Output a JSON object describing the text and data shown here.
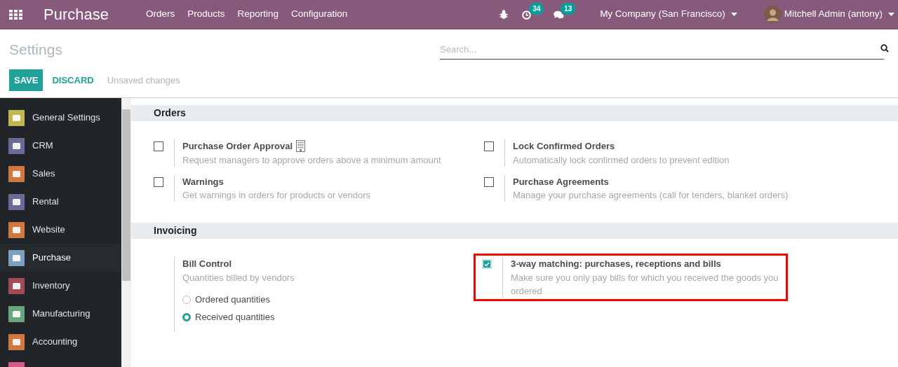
{
  "navbar": {
    "app_name": "Purchase",
    "menu": [
      "Orders",
      "Products",
      "Reporting",
      "Configuration"
    ],
    "activity_count": "34",
    "message_count": "13",
    "company": "My Company (San Francisco)",
    "user": "Mitchell Admin (antony)"
  },
  "control_panel": {
    "title": "Settings",
    "search": {
      "placeholder": "Search..."
    },
    "save": "SAVE",
    "discard": "DISCARD",
    "status": "Unsaved changes"
  },
  "sidebar": {
    "items": [
      {
        "label": "General Settings",
        "color": "#c2b64e",
        "selected": false
      },
      {
        "label": "CRM",
        "color": "#6c6a99",
        "selected": false
      },
      {
        "label": "Sales",
        "color": "#d2773f",
        "selected": false
      },
      {
        "label": "Rental",
        "color": "#6c6a99",
        "selected": false
      },
      {
        "label": "Website",
        "color": "#d2773f",
        "selected": false
      },
      {
        "label": "Purchase",
        "color": "#7ca2c2",
        "selected": true
      },
      {
        "label": "Inventory",
        "color": "#a34a55",
        "selected": false
      },
      {
        "label": "Manufacturing",
        "color": "#66a67a",
        "selected": false
      },
      {
        "label": "Accounting",
        "color": "#d2773f",
        "selected": false
      },
      {
        "color": "#d45a8a"
      }
    ]
  },
  "sections": [
    {
      "title": "Orders",
      "settings": [
        {
          "kind": "checkbox",
          "checked": false,
          "title": "Purchase Order Approval",
          "enterprise": true,
          "description": "Request managers to approve orders above a minimum amount"
        },
        {
          "kind": "checkbox",
          "checked": false,
          "title": "Lock Confirmed Orders",
          "description": "Automatically lock confirmed orders to prevent edition"
        },
        {
          "kind": "checkbox",
          "checked": false,
          "title": "Warnings",
          "description": "Get warnings in orders for products or vendors"
        },
        {
          "kind": "checkbox",
          "checked": false,
          "title": "Purchase Agreements",
          "description": "Manage your purchase agreements (call for tenders, blanket orders)"
        }
      ]
    },
    {
      "title": "Invoicing",
      "settings": [
        {
          "kind": "radio",
          "title": "Bill Control",
          "description": "Quantities billed by vendors",
          "options": [
            {
              "label": "Ordered quantities",
              "selected": false
            },
            {
              "label": "Received quantities",
              "selected": true
            }
          ]
        },
        {
          "kind": "checkbox",
          "checked": true,
          "highlighted": true,
          "title": "3-way matching: purchases, receptions and bills",
          "description": "Make sure you only pay bills for which you received the goods you ordered"
        }
      ]
    }
  ]
}
